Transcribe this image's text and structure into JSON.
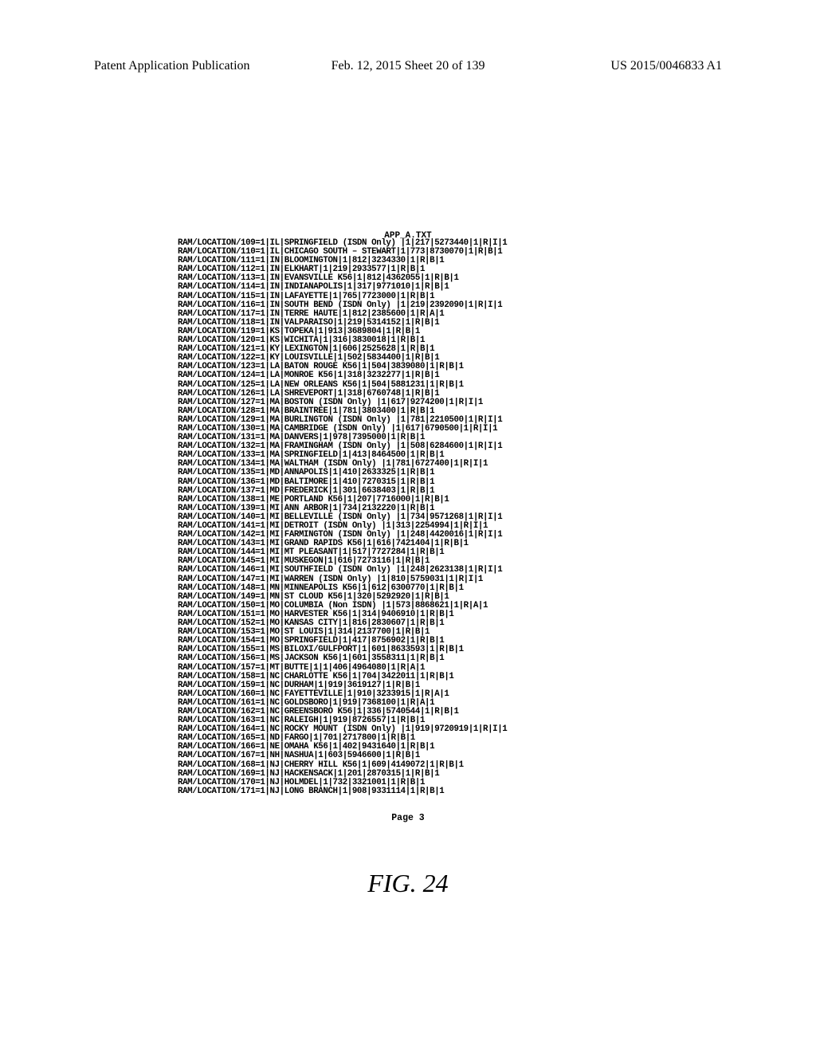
{
  "header": {
    "left": "Patent Application Publication",
    "center": "Feb. 12, 2015  Sheet 20 of 139",
    "right": "US 2015/0046833 A1"
  },
  "app_title": "APP_A.TXT",
  "page_num_label": "Page 3",
  "fig_caption": "FIG. 24",
  "rows": [
    "RAM/LOCATION/109=1|IL|SPRINGFIELD (ISDN Only) |1|217|5273440|1|R|I|1",
    "RAM/LOCATION/110=1|IL|CHICAGO SOUTH – STEWART|1|773|8730070|1|R|B|1",
    "RAM/LOCATION/111=1|IN|BLOOMINGTON|1|812|3234330|1|R|B|1",
    "RAM/LOCATION/112=1|IN|ELKHART|1|219|2933577|1|R|B|1",
    "RAM/LOCATION/113=1|IN|EVANSVILLE K56|1|812|4362055|1|R|B|1",
    "RAM/LOCATION/114=1|IN|INDIANAPOLIS|1|317|9771010|1|R|B|1",
    "RAM/LOCATION/115=1|IN|LAFAYETTE|1|765|7723000|1|R|B|1",
    "RAM/LOCATION/116=1|IN|SOUTH BEND (ISDN Only) |1|219|2392090|1|R|I|1",
    "RAM/LOCATION/117=1|IN|TERRE HAUTE|1|812|2385600|1|R|A|1",
    "RAM/LOCATION/118=1|IN|VALPARAISO|1|219|5314152|1|R|B|1",
    "RAM/LOCATION/119=1|KS|TOPEKA|1|913|3689804|1|R|B|1",
    "RAM/LOCATION/120=1|KS|WICHITA|1|316|3830018|1|R|B|1",
    "RAM/LOCATION/121=1|KY|LEXINGTON|1|606|2525628|1|R|B|1",
    "RAM/LOCATION/122=1|KY|LOUISVILLE|1|502|5834400|1|R|B|1",
    "RAM/LOCATION/123=1|LA|BATON ROUGE K56|1|504|3839080|1|R|B|1",
    "RAM/LOCATION/124=1|LA|MONROE K56|1|318|3232277|1|R|B|1",
    "RAM/LOCATION/125=1|LA|NEW ORLEANS K56|1|504|5881231|1|R|B|1",
    "RAM/LOCATION/126=1|LA|SHREVEPORT|1|318|6760748|1|R|B|1",
    "RAM/LOCATION/127=1|MA|BOSTON (ISDN Only) |1|617|9274200|1|R|I|1",
    "RAM/LOCATION/128=1|MA|BRAINTREE|1|781|3803400|1|R|B|1",
    "RAM/LOCATION/129=1|MA|BURLINGTON (ISDN Only) |1|781|2210500|1|R|I|1",
    "RAM/LOCATION/130=1|MA|CAMBRIDGE (ISDN Only) |1|617|6790500|1|R|I|1",
    "RAM/LOCATION/131=1|MA|DANVERS|1|978|7395000|1|R|B|1",
    "RAM/LOCATION/132=1|MA|FRAMINGHAM (ISDN Only) |1|508|6284600|1|R|I|1",
    "RAM/LOCATION/133=1|MA|SPRINGFIELD|1|413|8464500|1|R|B|1",
    "RAM/LOCATION/134=1|MA|WALTHAM (ISDN Only) |1|781|6727400|1|R|I|1",
    "RAM/LOCATION/135=1|MD|ANNAPOLIS|1|410|2633325|1|R|B|1",
    "RAM/LOCATION/136=1|MD|BALTIMORE|1|410|7270315|1|R|B|1",
    "RAM/LOCATION/137=1|MD|FREDERICK|1|301|6638403|1|R|B|1",
    "RAM/LOCATION/138=1|ME|PORTLAND K56|1|207|7716000|1|R|B|1",
    "RAM/LOCATION/139=1|MI|ANN ARBOR|1|734|2132220|1|R|B|1",
    "RAM/LOCATION/140=1|MI|BELLEVILLE (ISDN Only) |1|734|9571268|1|R|I|1",
    "RAM/LOCATION/141=1|MI|DETROIT (ISDN Only) |1|313|2254994|1|R|I|1",
    "RAM/LOCATION/142=1|MI|FARMINGTON (ISDN Only) |1|248|4420016|1|R|I|1",
    "RAM/LOCATION/143=1|MI|GRAND RAPIDS K56|1|616|7421404|1|R|B|1",
    "RAM/LOCATION/144=1|MI|MT PLEASANT|1|517|7727284|1|R|B|1",
    "RAM/LOCATION/145=1|MI|MUSKEGON|1|616|7273116|1|R|B|1",
    "RAM/LOCATION/146=1|MI|SOUTHFIELD (ISDN Only) |1|248|2623138|1|R|I|1",
    "RAM/LOCATION/147=1|MI|WARREN (ISDN Only) |1|810|5759031|1|R|I|1",
    "RAM/LOCATION/148=1|MN|MINNEAPOLIS K56|1|612|6300770|1|R|B|1",
    "RAM/LOCATION/149=1|MN|ST CLOUD K56|1|320|5292920|1|R|B|1",
    "RAM/LOCATION/150=1|MO|COLUMBIA (Non ISDN) |1|573|8868621|1|R|A|1",
    "RAM/LOCATION/151=1|MO|HARVESTER K56|1|314|9406910|1|R|B|1",
    "RAM/LOCATION/152=1|MO|KANSAS CITY|1|816|2830607|1|R|B|1",
    "RAM/LOCATION/153=1|MO|ST LOUIS|1|314|2137700|1|R|B|1",
    "RAM/LOCATION/154=1|MO|SPRINGFIELD|1|417|8756902|1|R|B|1",
    "RAM/LOCATION/155=1|MS|BILOXI/GULFPORT|1|601|8633593|1|R|B|1",
    "RAM/LOCATION/156=1|MS|JACKSON K56|1|601|3558311|1|R|B|1",
    "RAM/LOCATION/157=1|MT|BUTTE|1|1|406|4964080|1|R|A|1",
    "RAM/LOCATION/158=1|NC|CHARLOTTE K56|1|704|3422011|1|R|B|1",
    "RAM/LOCATION/159=1|NC|DURHAM|1|919|3619127|1|R|B|1",
    "RAM/LOCATION/160=1|NC|FAYETTEVILLE|1|910|3233915|1|R|A|1",
    "RAM/LOCATION/161=1|NC|GOLDSBORO|1|919|7368100|1|R|A|1",
    "RAM/LOCATION/162=1|NC|GREENSBORO K56|1|336|5740544|1|R|B|1",
    "RAM/LOCATION/163=1|NC|RALEIGH|1|919|8726557|1|R|B|1",
    "RAM/LOCATION/164=1|NC|ROCKY MOUNT (ISDN Only) |1|919|9720919|1|R|I|1",
    "RAM/LOCATION/165=1|ND|FARGO|1|701|2717800|1|R|B|1",
    "RAM/LOCATION/166=1|NE|OMAHA K56|1|402|9431640|1|R|B|1",
    "RAM/LOCATION/167=1|NH|NASHUA|1|603|5946600|1|R|B|1",
    "RAM/LOCATION/168=1|NJ|CHERRY HILL K56|1|609|4149072|1|R|B|1",
    "RAM/LOCATION/169=1|NJ|HACKENSACK|1|201|2870315|1|R|B|1",
    "RAM/LOCATION/170=1|NJ|HOLMDEL|1|732|3321001|1|R|B|1",
    "RAM/LOCATION/171=1|NJ|LONG BRANCH|1|908|9331114|1|R|B|1"
  ]
}
